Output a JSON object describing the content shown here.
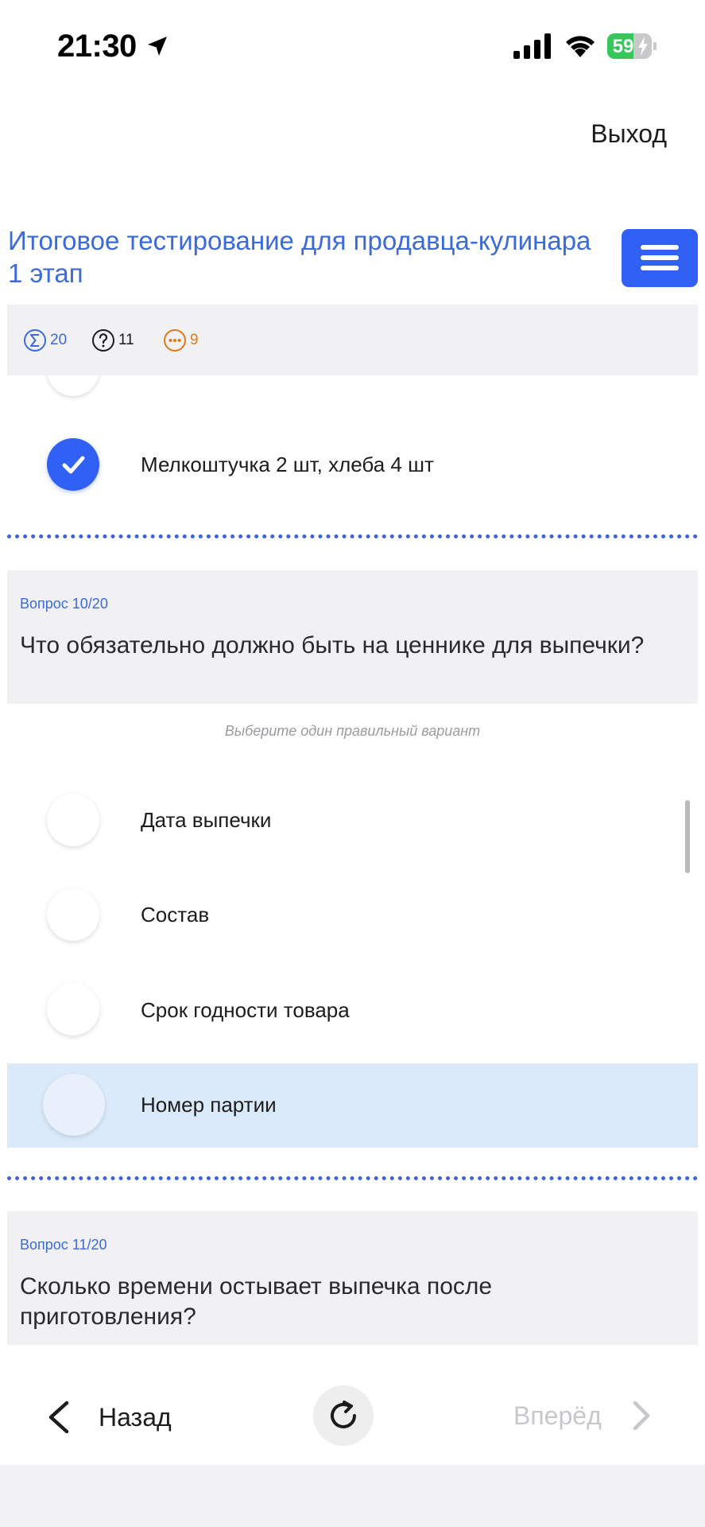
{
  "status_bar": {
    "time": "21:30",
    "battery_level": "59",
    "battery_percent": 59,
    "icons": [
      "location-arrow-icon",
      "cellular-signal-icon",
      "wifi-icon",
      "battery-charging-icon"
    ]
  },
  "header": {
    "exit_label": "Выход",
    "title": "Итоговое тестирование для продавца-кулинара 1 этап",
    "menu_icon": "hamburger-menu-icon"
  },
  "stats": {
    "total": "20",
    "unanswered": "11",
    "skipped": "9",
    "colors": {
      "total": "#3c6ad6",
      "unanswered": "#1c1c1e",
      "skipped": "#e07a18"
    }
  },
  "previous_question": {
    "selected_option": "Мелкоштучка 2 шт, хлеба 4 шт"
  },
  "question_10": {
    "number": "Вопрос 10/20",
    "text": "Что обязательно должно быть на ценнике для выпечки?",
    "hint": "Выберите один правильный вариант",
    "options": [
      {
        "label": "Дата выпечки",
        "selected": false,
        "highlighted": false
      },
      {
        "label": "Состав",
        "selected": false,
        "highlighted": false
      },
      {
        "label": "Срок годности товара",
        "selected": false,
        "highlighted": false
      },
      {
        "label": "Номер партии",
        "selected": false,
        "highlighted": true
      }
    ]
  },
  "question_11": {
    "number": "Вопрос 11/20",
    "text": "Сколько времени остывает выпечка после приготовления?"
  },
  "bottom_nav": {
    "back_label": "Назад",
    "forward_label": "Вперёд",
    "forward_enabled": false
  },
  "colors": {
    "accent": "#3161f4",
    "title": "#3c6ad6",
    "highlight": "#dbeafb",
    "card_bg": "#f1f1f3"
  }
}
